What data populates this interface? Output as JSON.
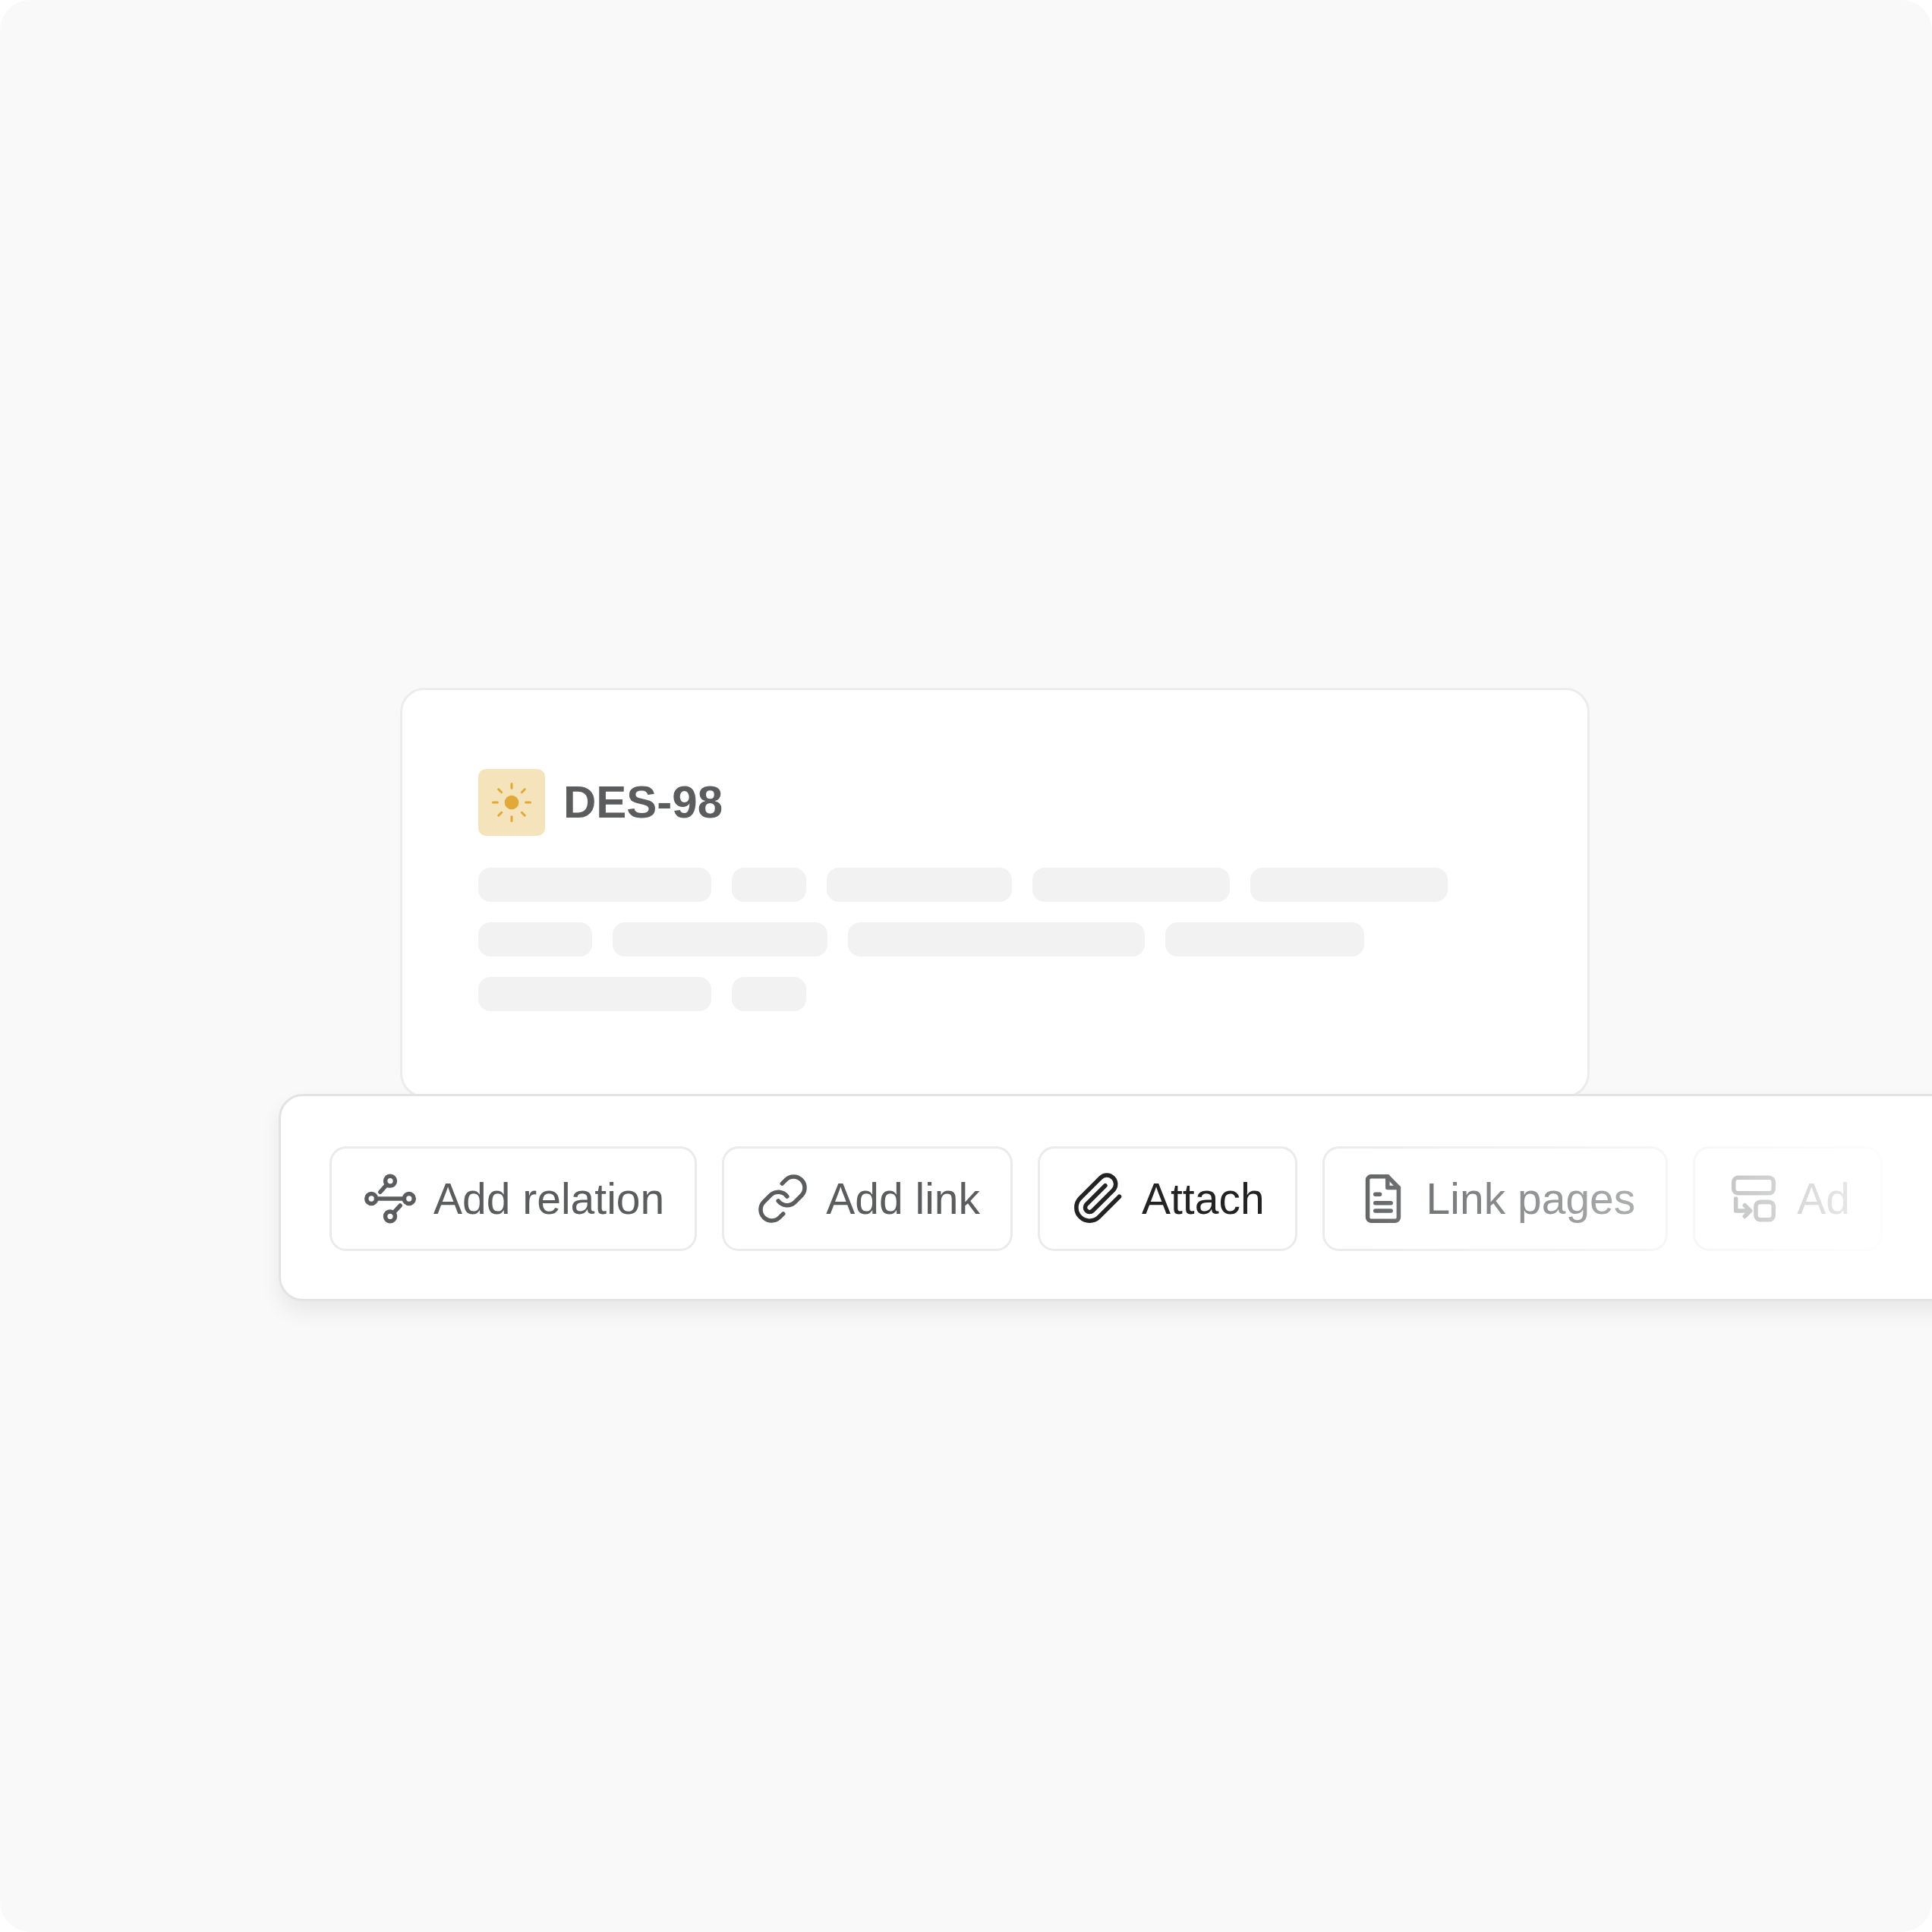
{
  "issue": {
    "id": "DES-98"
  },
  "actions": [
    {
      "label": "Add relation",
      "kind": "relation",
      "selected": false
    },
    {
      "label": "Add link",
      "kind": "link",
      "selected": false
    },
    {
      "label": "Attach",
      "kind": "attach",
      "selected": true
    },
    {
      "label": "Link pages",
      "kind": "pages",
      "selected": false
    },
    {
      "label": "Ad",
      "kind": "swap",
      "selected": false
    }
  ]
}
